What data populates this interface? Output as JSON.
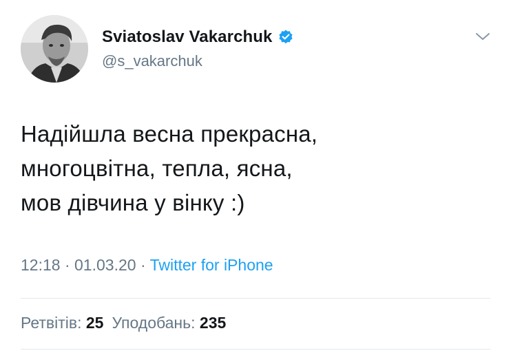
{
  "author": {
    "display_name": "Sviatoslav Vakarchuk",
    "handle": "@s_vakarchuk",
    "verified": true
  },
  "icons": {
    "verified": "verified-badge-icon",
    "menu": "chevron-down-icon",
    "avatar": "profile-photo"
  },
  "tweet": {
    "lines": [
      "Надійшла весна прекрасна,",
      "многоцвітна, тепла, ясна,",
      "мов дівчина у вінку :)"
    ],
    "time": "12:18",
    "date": "01.03.20",
    "separator": "·",
    "source": "Twitter for iPhone"
  },
  "stats": {
    "retweets_label": "Ретвітів:",
    "retweets_count": "25",
    "likes_label": "Уподобань:",
    "likes_count": "235"
  },
  "colors": {
    "text": "#14171a",
    "secondary": "#657786",
    "accent": "#1da1f2",
    "divider": "#e1e8ed"
  }
}
